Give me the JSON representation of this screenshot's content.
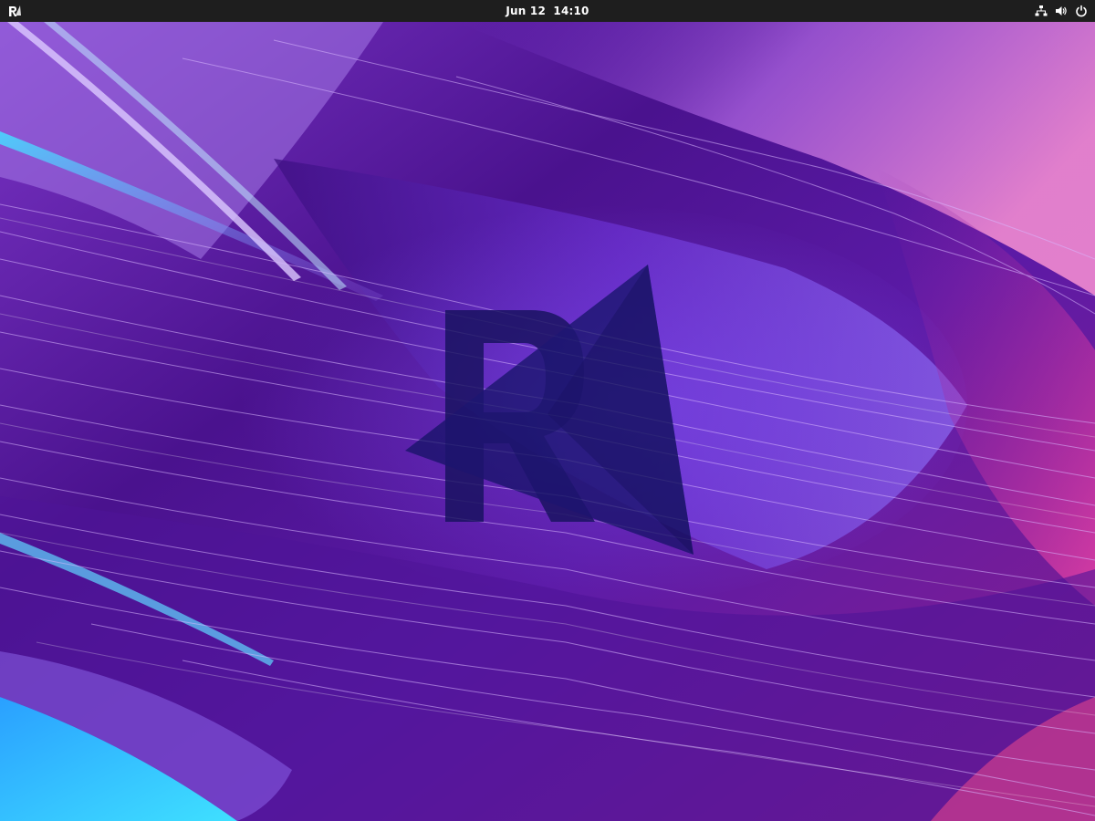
{
  "topbar": {
    "activities_icon": "distro-logo-icon",
    "clock": {
      "date": "Jun 12",
      "time": "14:10"
    },
    "tray": {
      "network_icon": "network-icon",
      "volume_icon": "volume-icon",
      "power_icon": "power-icon"
    }
  },
  "wallpaper": {
    "logo_letter": "R",
    "colors": {
      "base": "#2a0a5a",
      "purple": "#6a1fb8",
      "violet": "#9b4fe0",
      "magenta": "#d43fae",
      "cyan": "#33c8ff",
      "logo": "#14105a"
    }
  }
}
